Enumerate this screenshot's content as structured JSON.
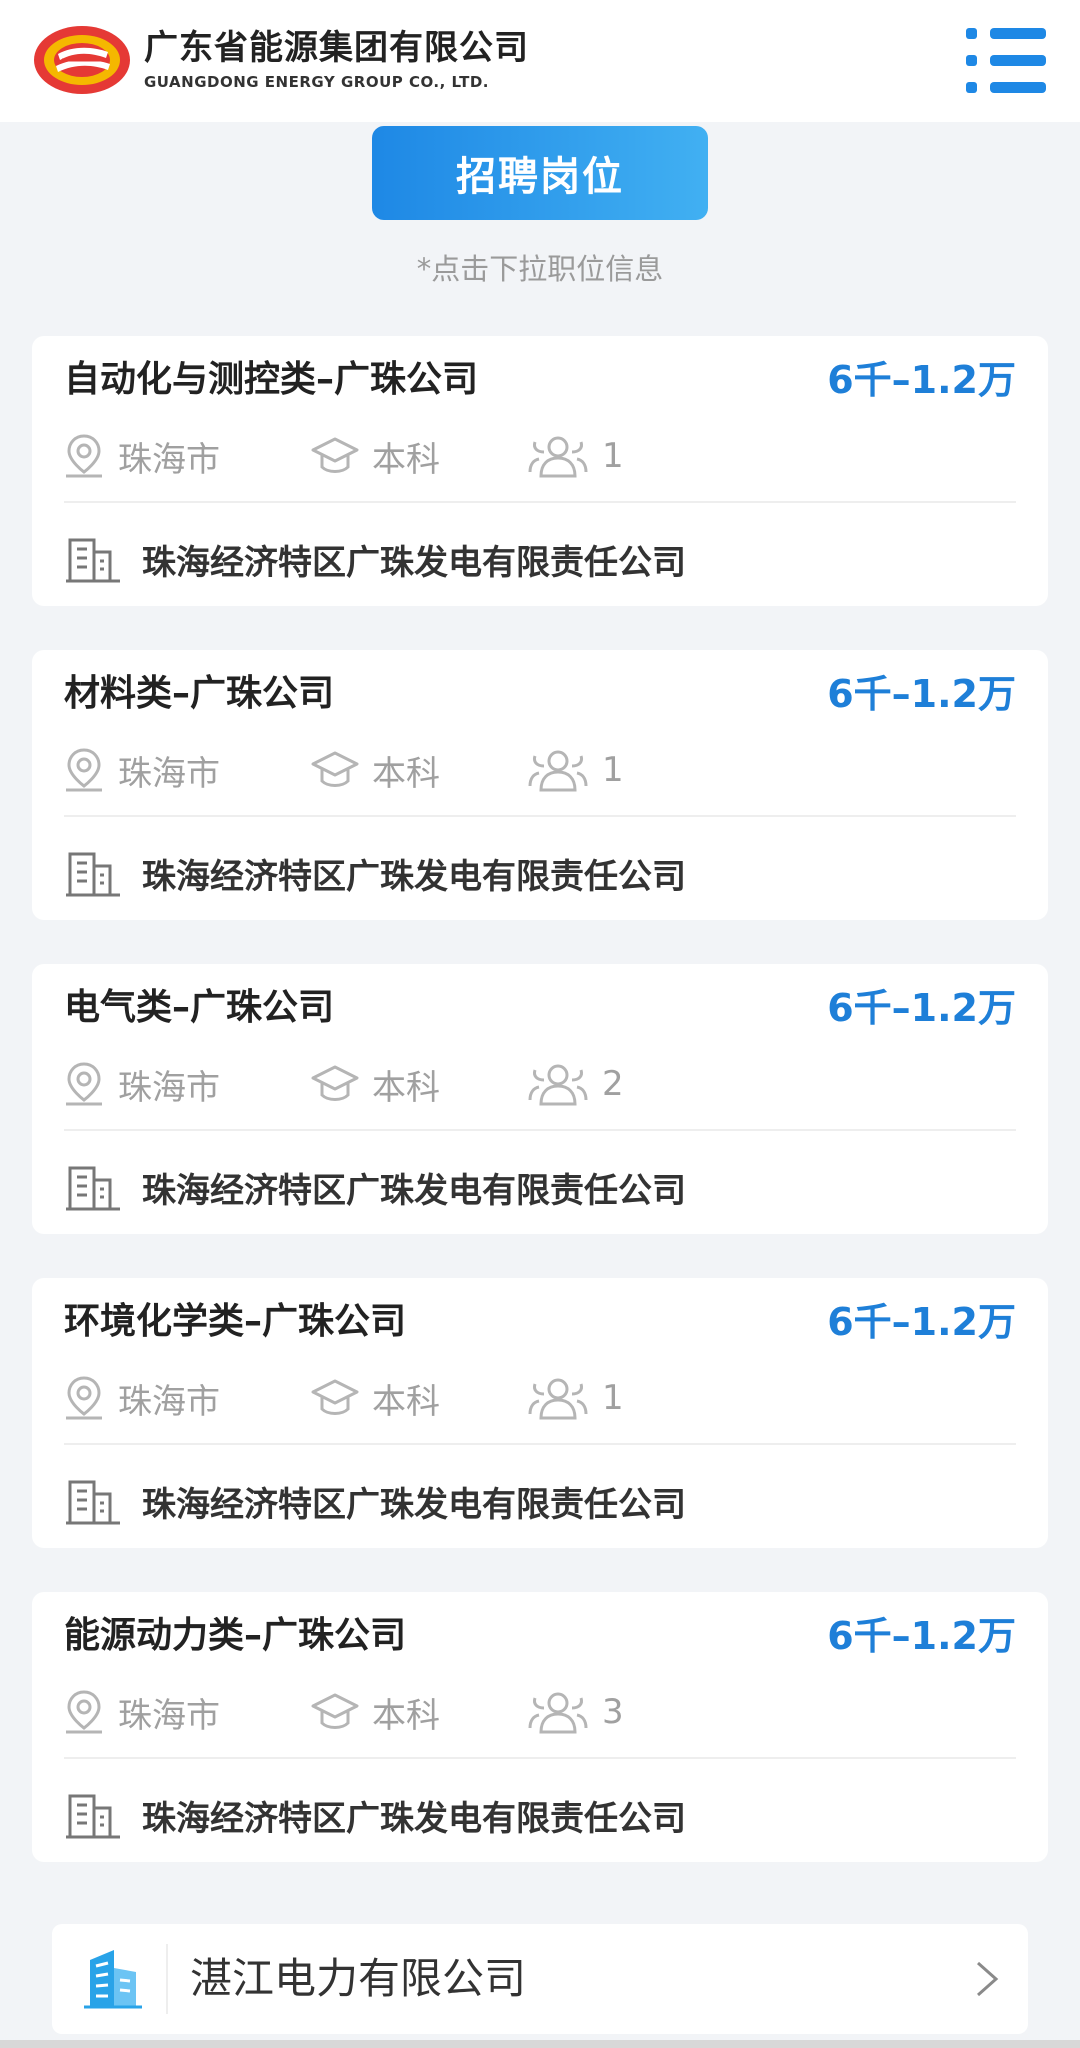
{
  "header": {
    "brand_cn": "广东省能源集团有限公司",
    "brand_en": "GUANGDONG ENERGY GROUP CO., LTD.",
    "logo_icon": "company-logo",
    "menu_icon": "menu-icon"
  },
  "jobs_button": {
    "label": "招聘岗位"
  },
  "hint": "*点击下拉职位信息",
  "jobs": [
    {
      "title": "自动化与测控类–广珠公司",
      "salary": "6千–1.2万",
      "city": "珠海市",
      "education": "本科",
      "headcount": "1",
      "company": "珠海经济特区广珠发电有限责任公司"
    },
    {
      "title": "材料类–广珠公司",
      "salary": "6千–1.2万",
      "city": "珠海市",
      "education": "本科",
      "headcount": "1",
      "company": "珠海经济特区广珠发电有限责任公司"
    },
    {
      "title": "电气类–广珠公司",
      "salary": "6千–1.2万",
      "city": "珠海市",
      "education": "本科",
      "headcount": "2",
      "company": "珠海经济特区广珠发电有限责任公司"
    },
    {
      "title": "环境化学类–广珠公司",
      "salary": "6千–1.2万",
      "city": "珠海市",
      "education": "本科",
      "headcount": "1",
      "company": "珠海经济特区广珠发电有限责任公司"
    },
    {
      "title": "能源动力类–广珠公司",
      "salary": "6千–1.2万",
      "city": "珠海市",
      "education": "本科",
      "headcount": "3",
      "company": "珠海经济特区广珠发电有限责任公司"
    }
  ],
  "section": {
    "label": "湛江电力有限公司",
    "icon": "building-icon",
    "chevron": "chevron-right-icon"
  },
  "colors": {
    "accent": "#1e88e5",
    "salary": "#1e7fd8",
    "background": "#f2f4f7",
    "logo_red": "#e53935",
    "logo_yellow": "#f5b800"
  }
}
